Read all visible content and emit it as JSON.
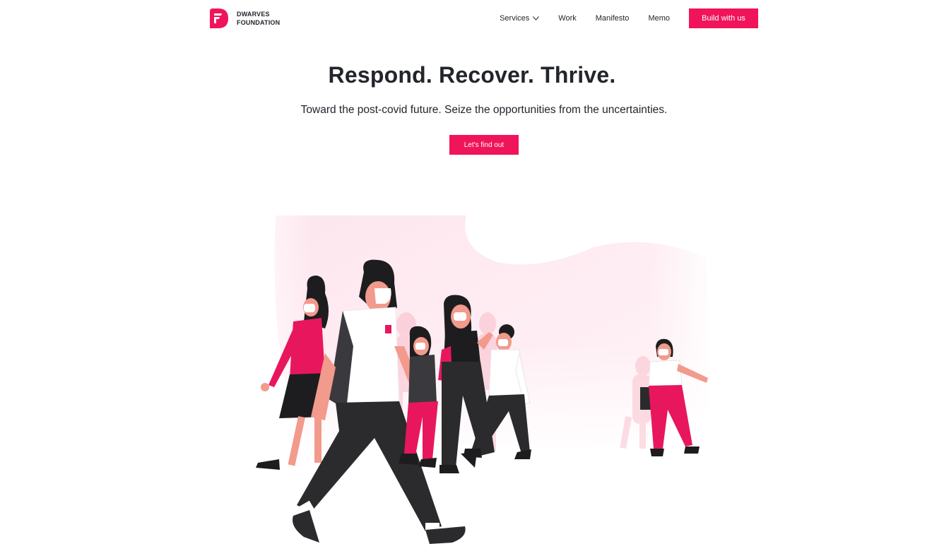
{
  "brand": {
    "line1": "DWARVES",
    "line2": "FOUNDATION",
    "color": "#f0145a"
  },
  "nav": {
    "items": [
      {
        "label": "Services",
        "has_dropdown": true
      },
      {
        "label": "Work"
      },
      {
        "label": "Manifesto"
      },
      {
        "label": "Memo"
      }
    ],
    "cta_label": "Build with us"
  },
  "hero": {
    "title": "Respond. Recover. Thrive.",
    "subtitle": "Toward the post-covid future. Seize the opportunities from the uncertainties.",
    "button_label": "Let's find out"
  },
  "illustration": {
    "icon": "people-walking-with-masks-illustration"
  }
}
